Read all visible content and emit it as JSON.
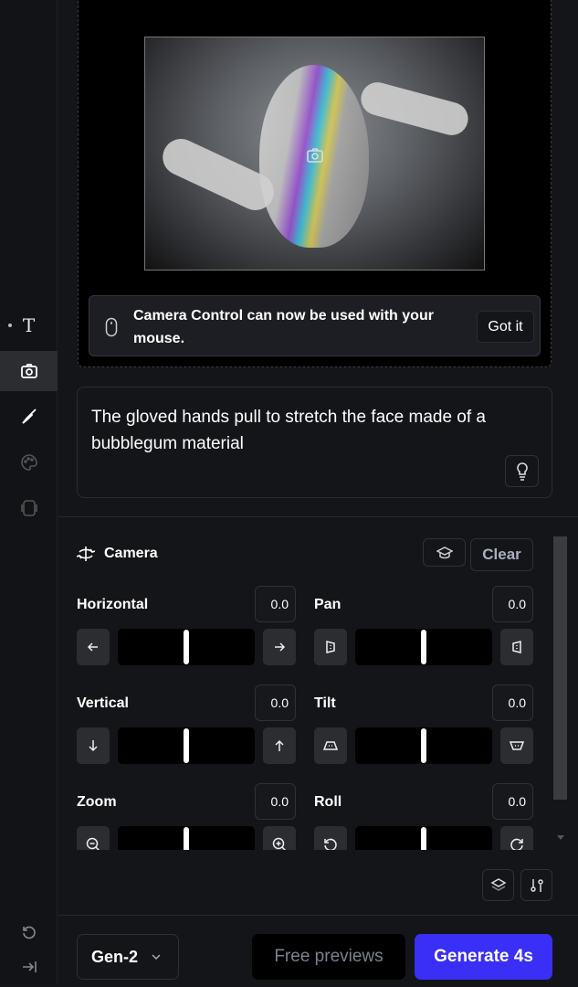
{
  "sidebar": {
    "items": [
      {
        "name": "text",
        "icon": "text-icon"
      },
      {
        "name": "camera",
        "icon": "camera-icon",
        "active": true
      },
      {
        "name": "brush",
        "icon": "brush-icon"
      },
      {
        "name": "palette",
        "icon": "palette-icon"
      },
      {
        "name": "frames",
        "icon": "frames-icon"
      }
    ],
    "bottom": [
      {
        "icon": "undo-icon"
      },
      {
        "icon": "collapse-icon"
      }
    ]
  },
  "notice": {
    "text": "Camera Control can now be used with your mouse.",
    "button": "Got it",
    "icon": "mouse-icon"
  },
  "prompt": {
    "text": "The gloved hands pull to stretch the face made of a bubblegum material",
    "icon": "lightbulb-icon"
  },
  "camera": {
    "title": "Camera",
    "clear": "Clear",
    "controls": [
      {
        "label": "Horizontal",
        "value": "0.0",
        "level": 0.5
      },
      {
        "label": "Pan",
        "value": "0.0",
        "level": 0.5
      },
      {
        "label": "Vertical",
        "value": "0.0",
        "level": 0.5
      },
      {
        "label": "Tilt",
        "value": "0.0",
        "level": 0.5
      },
      {
        "label": "Zoom",
        "value": "0.0",
        "level": 0.5
      },
      {
        "label": "Roll",
        "value": "0.0",
        "level": 0.5
      }
    ]
  },
  "footer": {
    "model": "Gen-2",
    "free_previews": "Free previews",
    "generate": "Generate 4s"
  },
  "colors": {
    "accent": "#3a2ff6",
    "background": "#141519"
  }
}
